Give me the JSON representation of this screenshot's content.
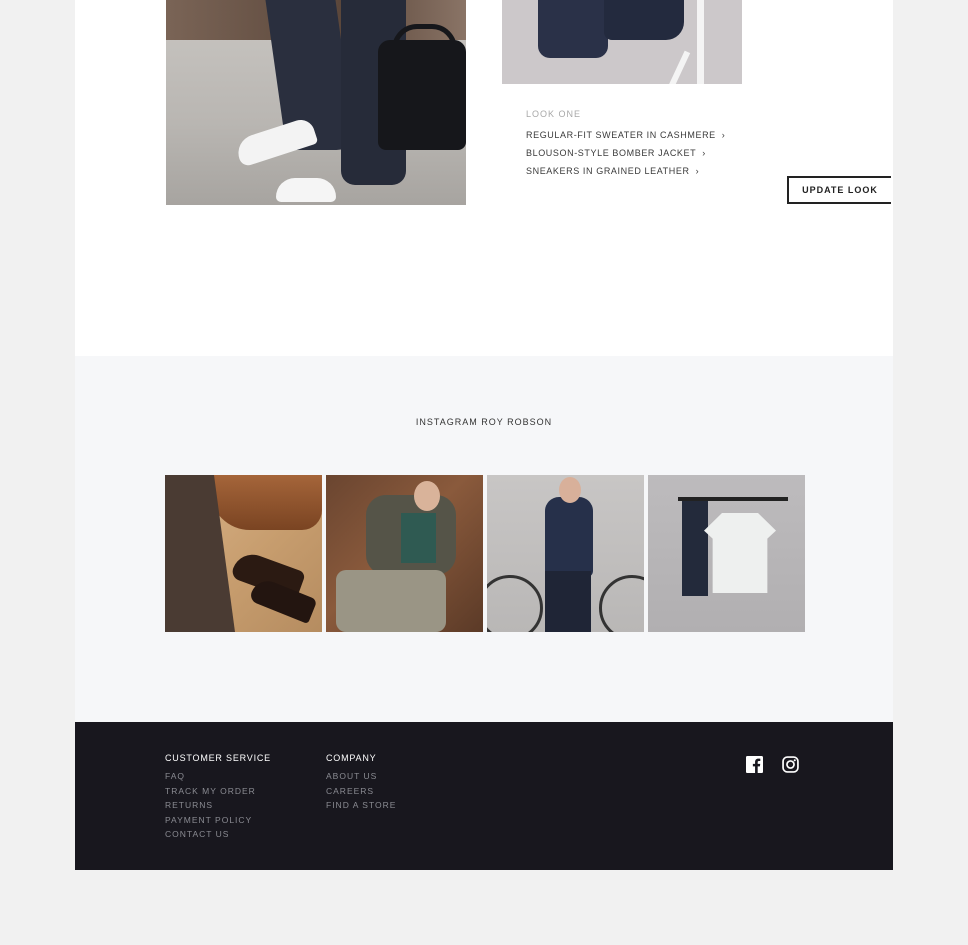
{
  "look": {
    "label": "LOOK ONE",
    "items": [
      {
        "label": "REGULAR-FIT SWEATER IN CASHMERE",
        "chevron": "›"
      },
      {
        "label": "BLOUSON-STYLE BOMBER JACKET",
        "chevron": "›"
      },
      {
        "label": "SNEAKERS IN GRAINED LEATHER",
        "chevron": "›"
      }
    ],
    "update_button": "UPDATE LOOK"
  },
  "instagram": {
    "title": "INSTAGRAM ROY ROBSON",
    "tiles": [
      "shoes-photo",
      "lounging-man-photo",
      "man-with-bicycle-photo",
      "hanging-clothes-photo"
    ]
  },
  "footer": {
    "customer_service": {
      "heading": "CUSTOMER SERVICE",
      "links": [
        "FAQ",
        "TRACK MY ORDER",
        "RETURNS",
        "PAYMENT POLICY",
        "CONTACT US"
      ]
    },
    "company": {
      "heading": "COMPANY",
      "links": [
        "ABOUT US",
        "CAREERS",
        "FIND A STORE"
      ]
    },
    "social": [
      "facebook-icon",
      "instagram-icon"
    ]
  },
  "colors": {
    "page_bg": "#f1f1f1",
    "footer_bg": "#18171e",
    "instagram_bg": "#f6f7f9",
    "text_dark": "#3a3a3a",
    "text_muted": "#a8a8a8"
  }
}
